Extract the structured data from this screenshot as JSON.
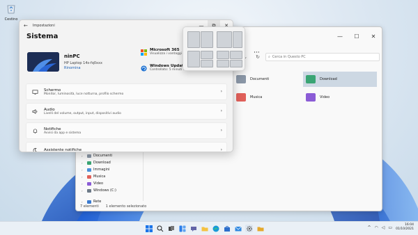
{
  "desktop": {
    "recycle_bin_label": "Cestino"
  },
  "settings": {
    "title": "Impostazioni",
    "heading": "Sistema",
    "device": {
      "name": "ninPC",
      "model": "HP Laptop 14s-fq0xxx",
      "rename": "Rinomina"
    },
    "quick": [
      {
        "title": "Microsoft 365",
        "sub": "Visualizza i vantaggi"
      },
      {
        "title": "Windows Update",
        "sub": "Controllato: 5 minuti fa"
      }
    ],
    "rows": [
      {
        "title": "Schermo",
        "sub": "Monitor, luminosità, luce notturna, profilo schermo"
      },
      {
        "title": "Audio",
        "sub": "Livelli del volume, output, input, dispositivi audio"
      },
      {
        "title": "Notifiche",
        "sub": "Avvisi da app e sistema"
      },
      {
        "title": "Assistente notifiche",
        "sub": ""
      }
    ],
    "controls": {
      "minimize": "—",
      "maximize": "⧉",
      "close": "✕"
    },
    "back_glyph": "←"
  },
  "explorer": {
    "toolbar_more": "···",
    "search_placeholder": "Cerca in Questo PC",
    "folders": [
      {
        "label": "Documenti",
        "color": "#8a96a6"
      },
      {
        "label": "Download",
        "color": "#3aa574"
      },
      {
        "label": "Musica",
        "color": "#e0605a"
      },
      {
        "label": "Video",
        "color": "#8b5cd6"
      }
    ],
    "selected_folder": "Download",
    "tree": [
      {
        "label": "Documenti",
        "color": "#8a96a6"
      },
      {
        "label": "Download",
        "color": "#3aa574"
      },
      {
        "label": "Immagini",
        "color": "#4a90d9"
      },
      {
        "label": "Musica",
        "color": "#e0605a"
      },
      {
        "label": "Video",
        "color": "#8b5cd6"
      },
      {
        "label": "Windows (C:)",
        "color": "#6d7a88"
      }
    ],
    "network": "Rete",
    "status_items": "7 elementi",
    "status_selected": "1 elemento selezionato",
    "controls": {
      "minimize": "—",
      "maximize": "☐",
      "close": "✕"
    }
  },
  "taskbar": {
    "time": "16:04",
    "date": "01/10/2021",
    "tray_up": "^"
  }
}
